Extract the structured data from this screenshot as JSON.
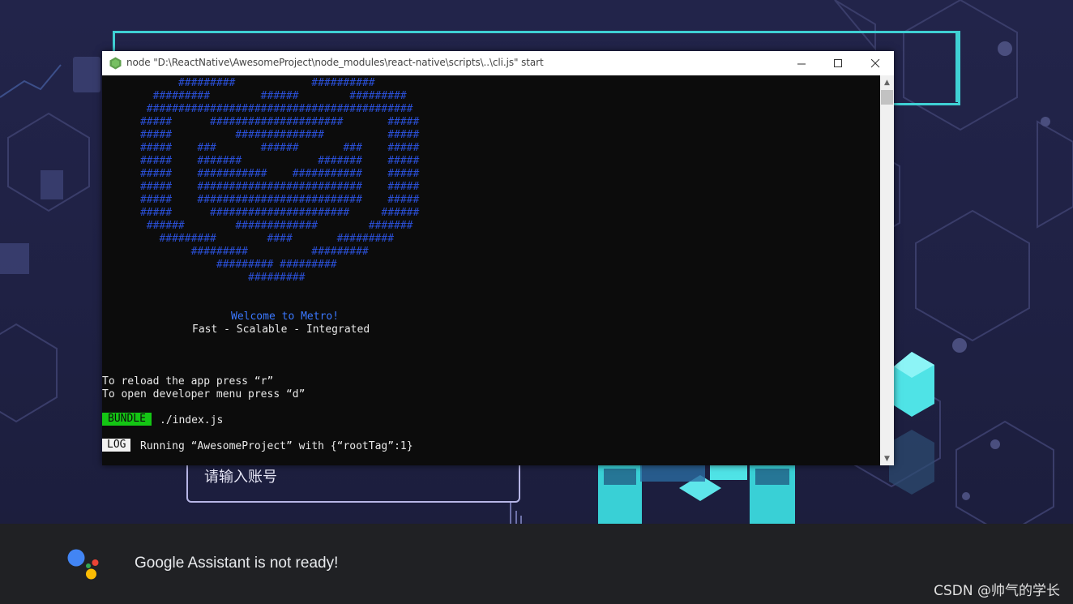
{
  "background": {
    "account_placeholder": "请输入账号"
  },
  "window": {
    "title": "node  \"D:\\ReactNative\\AwesomeProject\\node_modules\\react-native\\scripts\\..\\cli.js\" start",
    "minimize_icon": "minimize-icon",
    "maximize_icon": "maximize-icon",
    "close_icon": "close-icon"
  },
  "terminal": {
    "logo_ascii": "            #########            ##########\n        #########        ######        #########\n       ##########################################\n      #####      #####################       #####\n      #####          ##############          #####\n      #####    ###       ######       ###    #####\n      #####    #######            #######    #####\n      #####    ###########    ###########    #####\n      #####    ##########################    #####\n      #####    ##########################    #####\n      #####      ######################     ######\n       ######        #############        #######\n         #########        ####       #########\n              #########          #########\n                  ######### #########\n                       #########",
    "welcome": "Welcome to Metro!",
    "tagline": "Fast - Scalable - Integrated",
    "hint_reload": "To reload the app press “r”",
    "hint_devmenu": "To open developer menu press “d”",
    "bundle_badge": "BUNDLE",
    "bundle_file": "./index.js",
    "log_badge": "LOG",
    "log_text": "Running “AwesomeProject” with {“rootTag”:1}"
  },
  "assistant": {
    "message": "Google Assistant is not ready!"
  },
  "watermark": "CSDN @帅气的学长",
  "colors": {
    "terminal_bg": "#0c0c0c",
    "logo_blue": "#2a4fd6",
    "welcome_blue": "#3b78ff",
    "bundle_green": "#14c614",
    "accent_cyan": "#3fd0d4",
    "assistant_bar": "#202124"
  }
}
